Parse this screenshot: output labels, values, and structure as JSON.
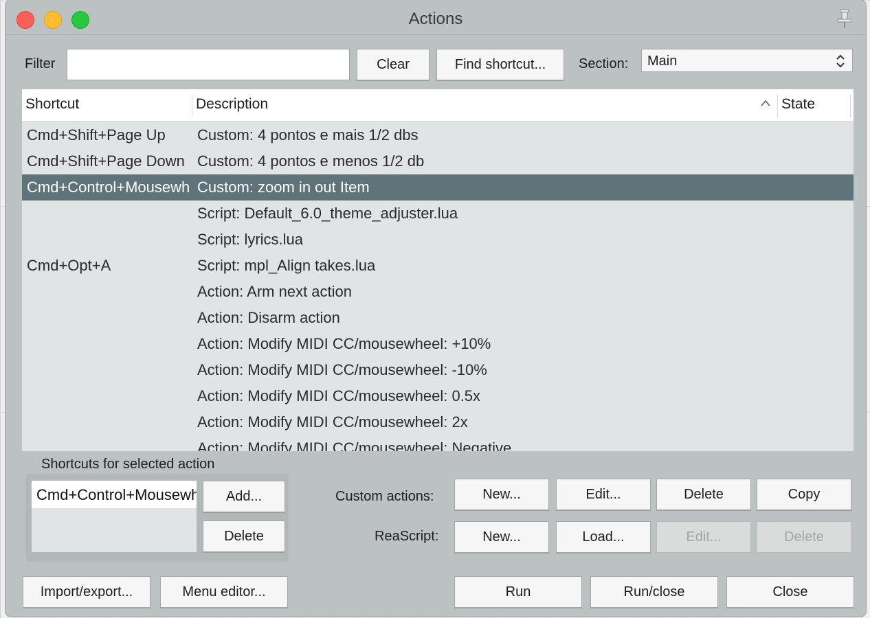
{
  "window": {
    "title": "Actions"
  },
  "filter": {
    "label": "Filter",
    "value": ""
  },
  "buttons": {
    "clear": "Clear",
    "find_shortcut": "Find shortcut...",
    "add": "Add...",
    "delete_shortcut": "Delete",
    "custom_new": "New...",
    "custom_edit": "Edit...",
    "custom_delete": "Delete",
    "custom_copy": "Copy",
    "script_new": "New...",
    "script_load": "Load...",
    "script_edit": "Edit...",
    "script_delete": "Delete",
    "import_export": "Import/export...",
    "menu_editor": "Menu editor...",
    "run": "Run",
    "run_close": "Run/close",
    "close": "Close"
  },
  "section": {
    "label": "Section:",
    "value": "Main"
  },
  "table": {
    "columns": [
      "Shortcut",
      "Description",
      "State"
    ],
    "rows": [
      {
        "shortcut": "Cmd+Shift+Page Up",
        "description": "Custom: 4 pontos e mais 1/2 dbs",
        "state": ""
      },
      {
        "shortcut": "Cmd+Shift+Page Down",
        "description": "Custom: 4 pontos e menos 1/2 db",
        "state": ""
      },
      {
        "shortcut": "Cmd+Control+Mousewheel",
        "description": "Custom: zoom in out Item",
        "state": "",
        "selected": true
      },
      {
        "shortcut": "",
        "description": "Script: Default_6.0_theme_adjuster.lua",
        "state": ""
      },
      {
        "shortcut": "",
        "description": "Script: lyrics.lua",
        "state": ""
      },
      {
        "shortcut": "Cmd+Opt+A",
        "description": "Script: mpl_Align takes.lua",
        "state": ""
      },
      {
        "shortcut": "",
        "description": "Action: Arm next action",
        "state": ""
      },
      {
        "shortcut": "",
        "description": "Action: Disarm action",
        "state": ""
      },
      {
        "shortcut": "",
        "description": "Action: Modify MIDI CC/mousewheel: +10%",
        "state": ""
      },
      {
        "shortcut": "",
        "description": "Action: Modify MIDI CC/mousewheel: -10%",
        "state": ""
      },
      {
        "shortcut": "",
        "description": "Action: Modify MIDI CC/mousewheel: 0.5x",
        "state": ""
      },
      {
        "shortcut": "",
        "description": "Action: Modify MIDI CC/mousewheel: 2x",
        "state": ""
      },
      {
        "shortcut": "",
        "description": "Action: Modify MIDI CC/mousewheel: Negative",
        "state": ""
      }
    ]
  },
  "shortcuts_panel": {
    "label": "Shortcuts for selected action",
    "items": [
      "Cmd+Control+Mousewheel"
    ]
  },
  "custom_actions_label": "Custom actions:",
  "reascript_label": "ReaScript:",
  "icons": {
    "pin": "pin-icon",
    "sort": "sort-ascending-icon",
    "select": "updown-chevrons-icon"
  }
}
